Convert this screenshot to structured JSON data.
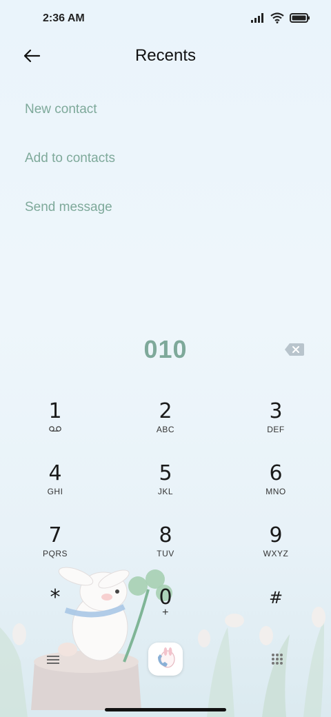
{
  "status_bar": {
    "time": "2:36 AM"
  },
  "header": {
    "title": "Recents"
  },
  "menu": {
    "new_contact": "New contact",
    "add_to_contacts": "Add to contacts",
    "send_message": "Send message"
  },
  "dialer": {
    "number": "010",
    "keys": [
      {
        "digit": "1",
        "letters": ""
      },
      {
        "digit": "2",
        "letters": "ABC"
      },
      {
        "digit": "3",
        "letters": "DEF"
      },
      {
        "digit": "4",
        "letters": "GHI"
      },
      {
        "digit": "5",
        "letters": "JKL"
      },
      {
        "digit": "6",
        "letters": "MNO"
      },
      {
        "digit": "7",
        "letters": "PQRS"
      },
      {
        "digit": "8",
        "letters": "TUV"
      },
      {
        "digit": "9",
        "letters": "WXYZ"
      },
      {
        "digit": "*",
        "letters": ""
      },
      {
        "digit": "0",
        "letters": "+"
      },
      {
        "digit": "#",
        "letters": ""
      }
    ]
  },
  "colors": {
    "accent": "#7ea99a",
    "background": "#eaf4fb"
  },
  "icons": [
    "back-arrow-icon",
    "signal-icon",
    "wifi-icon",
    "battery-icon",
    "backspace-icon",
    "voicemail-icon",
    "menu-icon",
    "call-icon",
    "keypad-icon"
  ]
}
